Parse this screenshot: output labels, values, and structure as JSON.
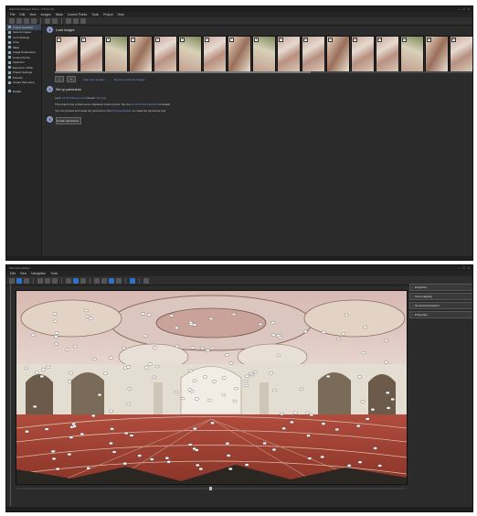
{
  "window1": {
    "title": "Stitch the Mosque Dome - PTGui Pro",
    "controls": [
      "–",
      "□",
      "×"
    ],
    "menu": [
      "File",
      "Edit",
      "View",
      "Images",
      "Mask",
      "Control Points",
      "Tools",
      "Project",
      "Help"
    ],
    "toolbar_icons": [
      "new-icon",
      "open-icon",
      "save-icon",
      "undo-icon",
      "redo-icon",
      "panorama-editor-icon",
      "control-points-icon",
      "optimize-icon",
      "settings-icon"
    ],
    "sidebar": [
      {
        "label": "Project Assistant",
        "active": true
      },
      {
        "label": "Source Images",
        "active": false
      },
      {
        "label": "Lens Settings",
        "active": false
      },
      {
        "label": "Crop",
        "active": false
      },
      {
        "label": "Mask",
        "active": false
      },
      {
        "label": "Image Parameters",
        "active": false
      },
      {
        "label": "Control Points",
        "active": false
      },
      {
        "label": "Optimizer",
        "active": false
      },
      {
        "label": "Exposure / HDR",
        "active": false
      },
      {
        "label": "Project Settings",
        "active": false
      },
      {
        "label": "Preview",
        "active": false
      },
      {
        "label": "Create Panorama",
        "active": false
      },
      {
        "label": "Details",
        "active": false
      }
    ],
    "step1": {
      "num": "1",
      "title": "Load images"
    },
    "thumbnails": [
      "0",
      "1",
      "2",
      "3",
      "4",
      "5",
      "6",
      "7",
      "8",
      "9",
      "10",
      "11",
      "12",
      "13",
      "14",
      "15",
      "16",
      "17"
    ],
    "image_tools": {
      "remove_label": "–",
      "add_label": "+",
      "link1": "Add more images...",
      "link2": "Remove selected images"
    },
    "step2": {
      "num": "2",
      "title": "Set up panorama"
    },
    "lens_line": {
      "lens_prefix": "Lens:",
      "lens_value": "12 mm fisheye lens",
      "camera_prefix": "Camera:",
      "camera_value": "Set crop"
    },
    "info_line1": {
      "text": "This project may contain some misplaced control points. See the",
      "link": "Control Point Assistant",
      "suffix": "for details."
    },
    "info_line2": {
      "text": "You can preview and tweak the panorama in the",
      "link": "Panorama Editor",
      "suffix": "or create the panorama now."
    },
    "step3": {
      "num": "3"
    },
    "create_button": "Create panorama..."
  },
  "window2": {
    "title": "Panorama Editor",
    "controls": [
      "–",
      "□",
      "×"
    ],
    "menu": [
      "Edit",
      "View",
      "Navigation",
      "Tools"
    ],
    "toolbar_icons": [
      "select-icon",
      "move-icon",
      "rotate-icon",
      "grid-icon",
      "numbers-icon",
      "crosshair-icon",
      "zoom-icon",
      "projection-icon",
      "fit-icon",
      "lock-icon",
      "view-icon",
      "center-icon",
      "exposure-icon",
      "help-icon"
    ],
    "panels": [
      "Projection",
      "Tone mapping",
      "Numerical transform",
      "Properties"
    ],
    "colors": {
      "accent": "#2f72c9",
      "link": "#6f9be0",
      "step": "#8a9cc8"
    }
  }
}
